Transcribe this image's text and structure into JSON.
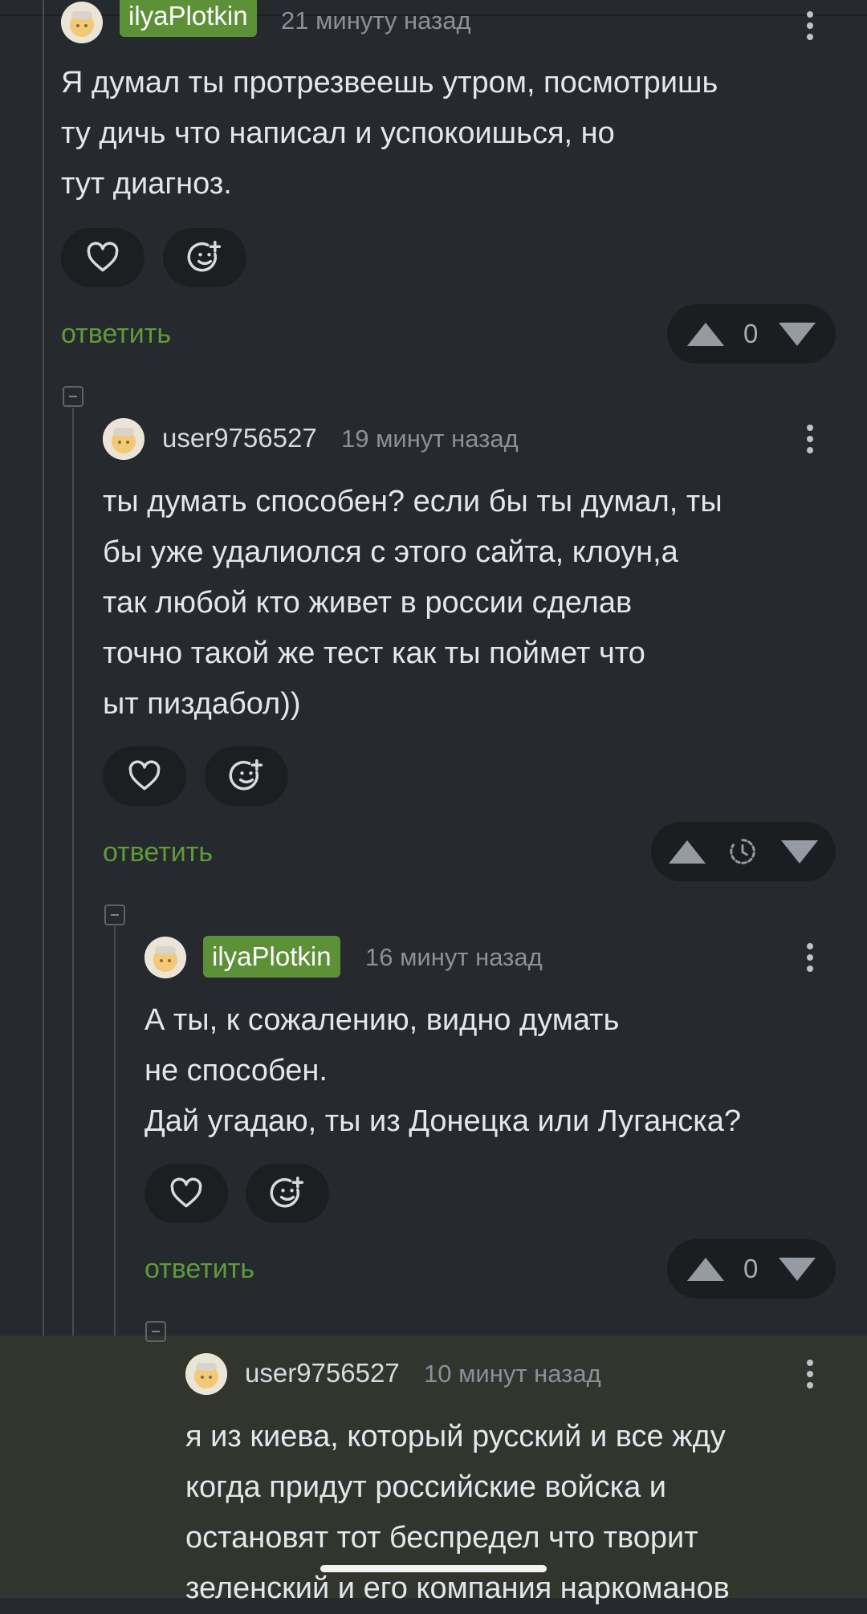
{
  "comments": [
    {
      "author": "ilyaPlotkin",
      "is_op": true,
      "time": "21 минуту назад",
      "text": "Я думал ты протрезвеешь утром, посмотришь\nту дичь что написал и успокоишься, но\nтут диагноз.",
      "reply_label": "ответить",
      "score": "0"
    },
    {
      "author": "user9756527",
      "is_op": false,
      "time": "19 минут назад",
      "text": "ты думать способен? если бы ты думал, ты\nбы уже удалиолся с этого сайта, клоун,а\nтак любой кто живет в россии сделав\nточно такой же тест как ты поймет что\nыт пиздабол))",
      "reply_label": "ответить",
      "score_icon": "clock-icon"
    },
    {
      "author": "ilyaPlotkin",
      "is_op": true,
      "time": "16 минут назад",
      "text": "А ты, к сожалению, видно думать\nне способен.\nДай угадаю, ты из Донецка или Луганска?",
      "reply_label": "ответить",
      "score": "0"
    },
    {
      "author": "user9756527",
      "is_op": false,
      "time": "10 минут назад",
      "text": "я из киева, который русский и все жду\nкогда придут российские войска и\nостановят тот беспредел что творит\nзеленский и его компания наркоманов"
    }
  ],
  "icons": {
    "like": "heart-icon",
    "reaction": "add-emoji-icon",
    "upvote": "arrow-up-icon",
    "downvote": "arrow-down-icon",
    "menu": "more-vertical-icon",
    "collapse": "collapse-minus-icon"
  },
  "colors": {
    "background": "#26292e",
    "highlight_background": "#32342e",
    "op_badge": "#5c9138",
    "reply_link": "#5e9b3a",
    "pill_background": "#1c1e22"
  }
}
